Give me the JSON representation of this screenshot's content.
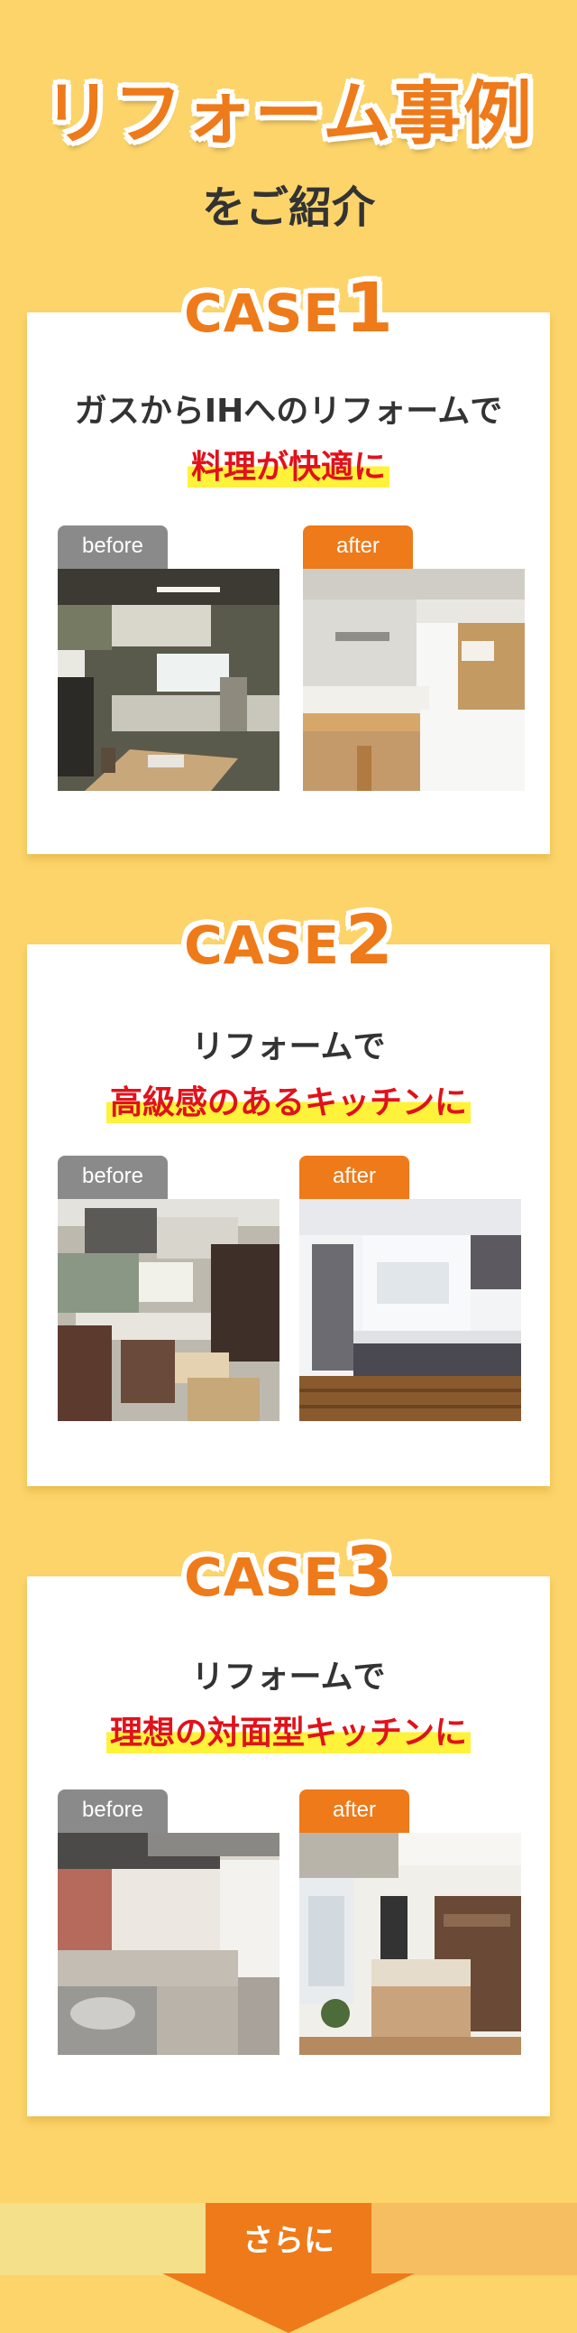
{
  "header": {
    "title": "リフォーム事例",
    "subtitle": "をご紹介"
  },
  "cases": [
    {
      "case_word": "CASE",
      "case_number": "1",
      "headline": "ガスからIHへのリフォームで",
      "highlight": "料理が快適に",
      "before_label": "before",
      "after_label": "after"
    },
    {
      "case_word": "CASE",
      "case_number": "2",
      "headline": "リフォームで",
      "highlight": "高級感のあるキッチンに",
      "before_label": "before",
      "after_label": "after"
    },
    {
      "case_word": "CASE",
      "case_number": "3",
      "headline": "リフォームで",
      "highlight": "理想の対面型キッチンに",
      "before_label": "before",
      "after_label": "after"
    }
  ],
  "footer": {
    "more_label": "さらに"
  },
  "colors": {
    "background": "#fcd46a",
    "accent_orange": "#ee7a1a",
    "highlight_red": "#e0121b",
    "marker_yellow": "#fff23a",
    "before_gray": "#8a8a8a"
  }
}
